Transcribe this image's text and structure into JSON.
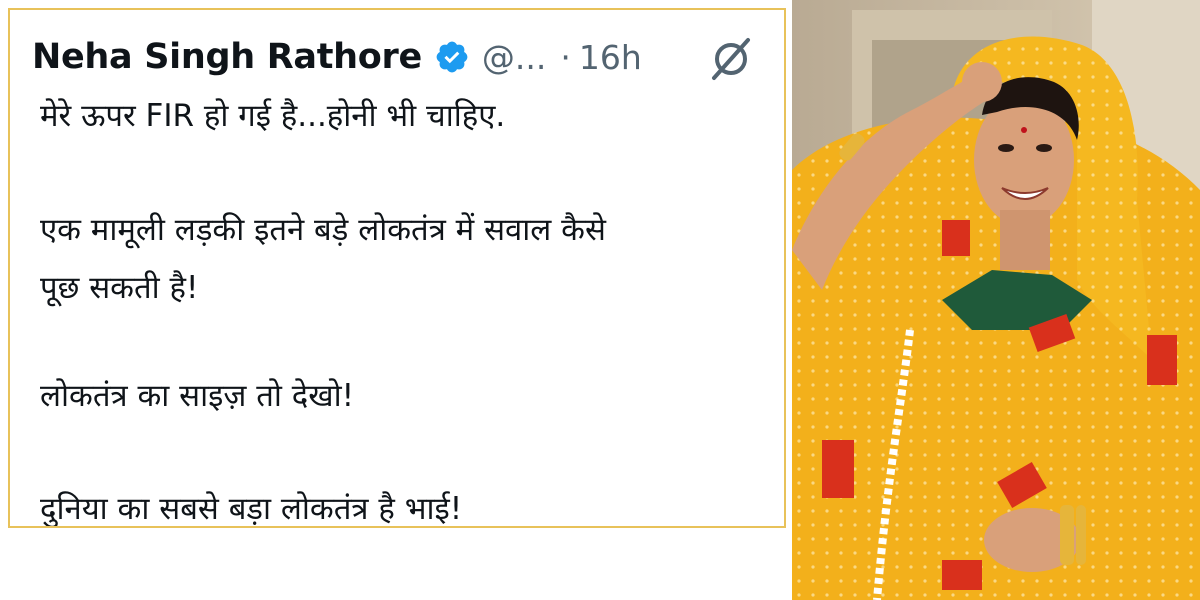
{
  "tweet": {
    "author_name": "Neha Singh Rathore",
    "handle": "@...",
    "separator": "·",
    "time": "16h",
    "lines": [
      "मेरे ऊपर FIR हो गई है...होनी भी चाहिए.",
      "एक मामूली लड़की इतने बड़े लोकतंत्र में सवाल कैसे",
      "पूछ सकती है!",
      "लोकतंत्र का साइज़ तो देखो!",
      "दुनिया का सबसे बड़ा लोकतंत्र है भाई!"
    ]
  },
  "icons": {
    "verified": "verified-badge-icon",
    "grok": "grok-icon"
  },
  "colors": {
    "card_border": "#e8c25a",
    "verified_blue": "#1d9bf0",
    "text": "#0f1419",
    "muted": "#536471",
    "saree_yellow": "#f5b21a",
    "saree_red": "#d9301c"
  }
}
